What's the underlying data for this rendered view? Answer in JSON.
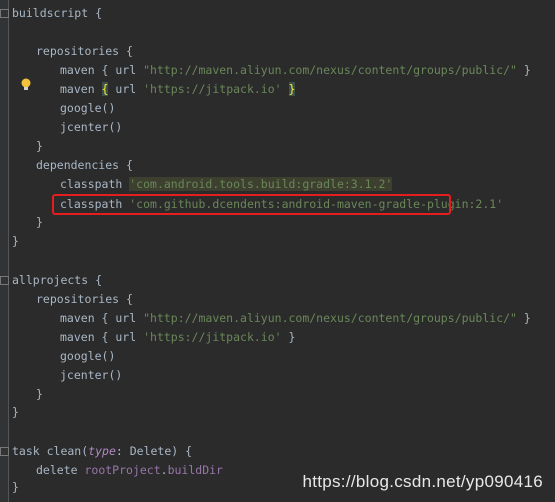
{
  "colors": {
    "background": "#2b2b2b",
    "text": "#a9b7c6",
    "string": "#6a8759",
    "parameter": "#b389c5",
    "highlight_box": "#e41e1e"
  },
  "code": {
    "l1": "buildscript {",
    "l3": "repositories {",
    "l4_kw": "maven { url ",
    "l4_str": "\"http://maven.aliyun.com/nexus/content/groups/public/\"",
    "l4_end": " }",
    "l5_kw": "maven ",
    "l5_brace": "{",
    "l5_mid": " url ",
    "l5_str": "'https://jitpack.io'",
    "l5_end_brace": "}",
    "l6": "google()",
    "l7": "jcenter()",
    "l8": "}",
    "l9": "dependencies {",
    "l10_kw": "classpath ",
    "l10_str": "'com.android.tools.build:gradle:3.1.2'",
    "l11_kw": "classpath ",
    "l11_str": "'com.github.dcendents:android-maven-gradle-plugin:2.1'",
    "l12": "}",
    "l13": "}",
    "l16": "allprojects {",
    "l17": "repositories {",
    "l18_kw": "maven { url ",
    "l18_str": "\"http://maven.aliyun.com/nexus/content/groups/public/\"",
    "l18_end": " }",
    "l19_kw": "maven { url ",
    "l19_str": "'https://jitpack.io'",
    "l19_end": " }",
    "l20": "google()",
    "l21": "jcenter()",
    "l22": "}",
    "l23": "}",
    "l25_a": "task clean(",
    "l25_param": "type",
    "l25_b": ": Delete) {",
    "l26_a": "delete ",
    "l26_field": "rootProject",
    "l26_b": ".",
    "l26_field2": "buildDir",
    "l27": "}"
  },
  "watermark": "https://blog.csdn.net/yp090416",
  "icons": {
    "intention": "lightbulb-icon"
  }
}
